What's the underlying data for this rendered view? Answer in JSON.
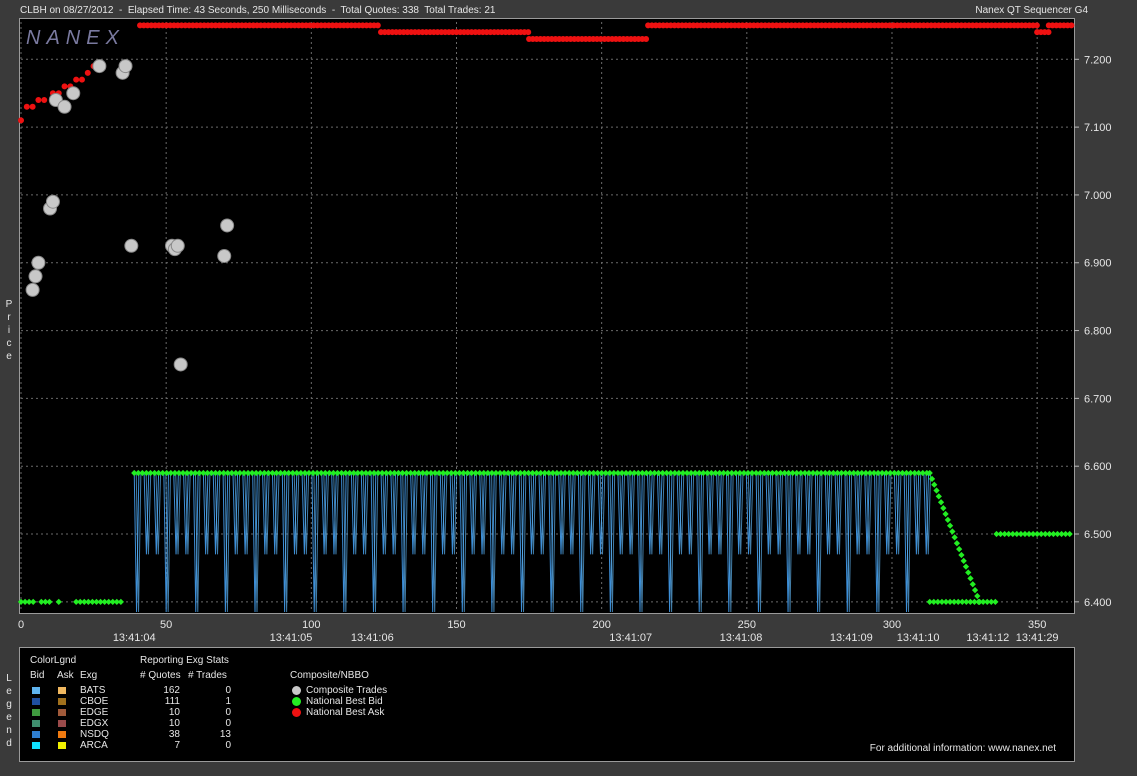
{
  "header": {
    "left_text": "CLBH on 08/27/2012  -  Elapsed Time: 43 Seconds, 250 Milliseconds  -  Total Quotes: 338  Total Trades: 21",
    "right_text": "Nanex QT Sequencer G4"
  },
  "watermark": "NANEX",
  "y_axis_label": "Price",
  "legend_side_label": "Legend",
  "legend": {
    "title_colorlgnd": "ColorLgnd",
    "title_stats": "Reporting Exg Stats",
    "title_composite": "Composite/NBBO",
    "col_bid": "Bid",
    "col_ask": "Ask",
    "col_exg": "Exg",
    "col_quotes": "# Quotes",
    "col_trades": "# Trades",
    "exchanges": [
      {
        "name": "BATS",
        "quotes": "162",
        "trades": "0",
        "bid_color": "#5fb4ef",
        "ask_color": "#f0b860"
      },
      {
        "name": "CBOE",
        "quotes": "111",
        "trades": "1",
        "bid_color": "#1f4fa0",
        "ask_color": "#a0701c"
      },
      {
        "name": "EDGE",
        "quotes": "10",
        "trades": "0",
        "bid_color": "#3f9a3f",
        "ask_color": "#a05a3a"
      },
      {
        "name": "EDGX",
        "quotes": "10",
        "trades": "0",
        "bid_color": "#3f8f6f",
        "ask_color": "#9a4a4a"
      },
      {
        "name": "NSDQ",
        "quotes": "38",
        "trades": "13",
        "bid_color": "#2f7fd0",
        "ask_color": "#f07a10"
      },
      {
        "name": "ARCA",
        "quotes": "7",
        "trades": "0",
        "bid_color": "#10e0ff",
        "ask_color": "#f0f000"
      }
    ],
    "composite": [
      {
        "label": "Composite Trades",
        "color": "#c8c8c8"
      },
      {
        "label": "National Best Bid",
        "color": "#22ee22"
      },
      {
        "label": "National Best Ask",
        "color": "#ee1111"
      }
    ],
    "info": "For additional information: www.nanex.net"
  },
  "chart_data": {
    "type": "scatter",
    "title": "CLBH on 08/27/2012",
    "xlabel": "",
    "ylabel": "Price",
    "xlim": [
      0,
      362
    ],
    "ylim": [
      6.385,
      7.255
    ],
    "grid": true,
    "x_ticks": [
      "0",
      "50",
      "100",
      "150",
      "200",
      "250",
      "300",
      "350"
    ],
    "x_tick_values": [
      0,
      50,
      100,
      150,
      200,
      250,
      300,
      350
    ],
    "y_ticks": [
      "6.400",
      "6.500",
      "6.600",
      "6.700",
      "6.800",
      "6.900",
      "7.000",
      "7.100",
      "7.200"
    ],
    "y_tick_values": [
      6.4,
      6.5,
      6.6,
      6.7,
      6.8,
      6.9,
      7.0,
      7.1,
      7.2
    ],
    "time_labels": [
      {
        "x": 39,
        "label": "13:41:04"
      },
      {
        "x": 93,
        "label": "13:41:05"
      },
      {
        "x": 121,
        "label": "13:41:06"
      },
      {
        "x": 210,
        "label": "13:41:07"
      },
      {
        "x": 248,
        "label": "13:41:08"
      },
      {
        "x": 286,
        "label": "13:41:09"
      },
      {
        "x": 309,
        "label": "13:41:10"
      },
      {
        "x": 333,
        "label": "13:41:12"
      },
      {
        "x": 350,
        "label": "13:41:29"
      }
    ],
    "series": [
      {
        "name": "National Best Bid",
        "color": "#22ee22",
        "segments": [
          {
            "x0": 0,
            "x1": 5,
            "y": 6.4
          },
          {
            "x0": 7,
            "x1": 10,
            "y": 6.4
          },
          {
            "x0": 13,
            "x1": 14,
            "y": 6.4
          },
          {
            "x0": 19,
            "x1": 35,
            "y": 6.4
          },
          {
            "x0": 39,
            "x1": 313,
            "y": 6.59
          },
          {
            "x0": 313,
            "x1": 330,
            "y": 6.4
          },
          {
            "x0": 330,
            "x1": 336,
            "y": 6.4
          },
          {
            "x0": 336,
            "x1": 362,
            "y": 6.5
          }
        ]
      },
      {
        "name": "National Best Ask",
        "color": "#ee1111",
        "points": [
          [
            0,
            7.11
          ],
          [
            2,
            7.13
          ],
          [
            4,
            7.13
          ],
          [
            6,
            7.14
          ],
          [
            8,
            7.14
          ],
          [
            11,
            7.15
          ],
          [
            13,
            7.15
          ],
          [
            15,
            7.16
          ],
          [
            17,
            7.16
          ],
          [
            19,
            7.17
          ],
          [
            21,
            7.17
          ],
          [
            23,
            7.18
          ],
          [
            25,
            7.19
          ],
          [
            27,
            7.19
          ]
        ],
        "segments": [
          {
            "x0": 41,
            "x1": 124,
            "y": 7.25
          },
          {
            "x0": 124,
            "x1": 175,
            "y": 7.24
          },
          {
            "x0": 175,
            "x1": 216,
            "y": 7.23
          },
          {
            "x0": 216,
            "x1": 350,
            "y": 7.25
          },
          {
            "x0": 350,
            "x1": 354,
            "y": 7.24
          },
          {
            "x0": 354,
            "x1": 362,
            "y": 7.25
          }
        ]
      },
      {
        "name": "Composite Trades",
        "color": "#c8c8c8",
        "points": [
          [
            4,
            6.86
          ],
          [
            5,
            6.88
          ],
          [
            6,
            6.9
          ],
          [
            10,
            6.98
          ],
          [
            11,
            6.99
          ],
          [
            12,
            7.14
          ],
          [
            15,
            7.13
          ],
          [
            18,
            7.15
          ],
          [
            27,
            7.19
          ],
          [
            35,
            7.18
          ],
          [
            36,
            7.19
          ],
          [
            38,
            6.925
          ],
          [
            52,
            6.925
          ],
          [
            53,
            6.92
          ],
          [
            54,
            6.925
          ],
          [
            55,
            6.75
          ],
          [
            70,
            6.91
          ],
          [
            71,
            6.955
          ]
        ]
      }
    ]
  }
}
